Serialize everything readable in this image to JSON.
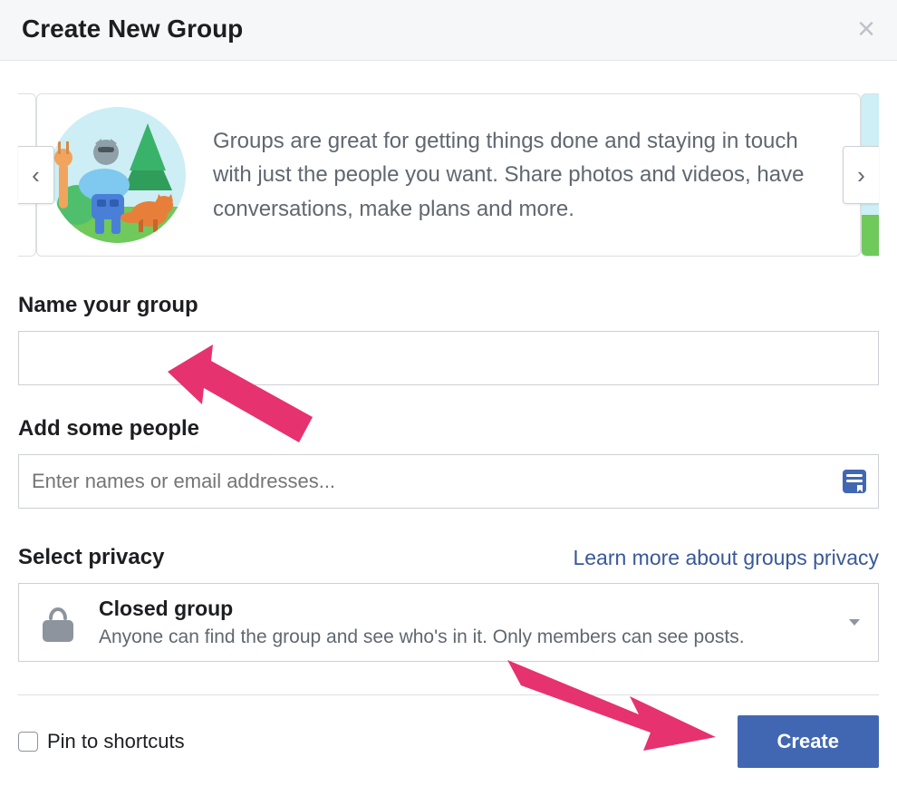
{
  "modal": {
    "title": "Create New Group",
    "banner_text": "Groups are great for getting things done and staying in touch with just the people you want. Share photos and videos, have conversations, make plans and more."
  },
  "sections": {
    "name_label": "Name your group",
    "name_value": "",
    "people_label": "Add some people",
    "people_placeholder": "Enter names or email addresses...",
    "privacy_label": "Select privacy",
    "privacy_link": "Learn more about groups privacy"
  },
  "privacy": {
    "selected_title": "Closed group",
    "selected_description": "Anyone can find the group and see who's in it. Only members can see posts."
  },
  "footer": {
    "pin_label": "Pin to shortcuts",
    "pin_checked": false,
    "create_label": "Create"
  },
  "icons": {
    "close": "close-icon",
    "nav_left": "chevron-left-icon",
    "nav_right": "chevron-right-icon",
    "people_list": "contact-list-icon",
    "lock": "lock-icon",
    "caret": "chevron-down-icon"
  }
}
